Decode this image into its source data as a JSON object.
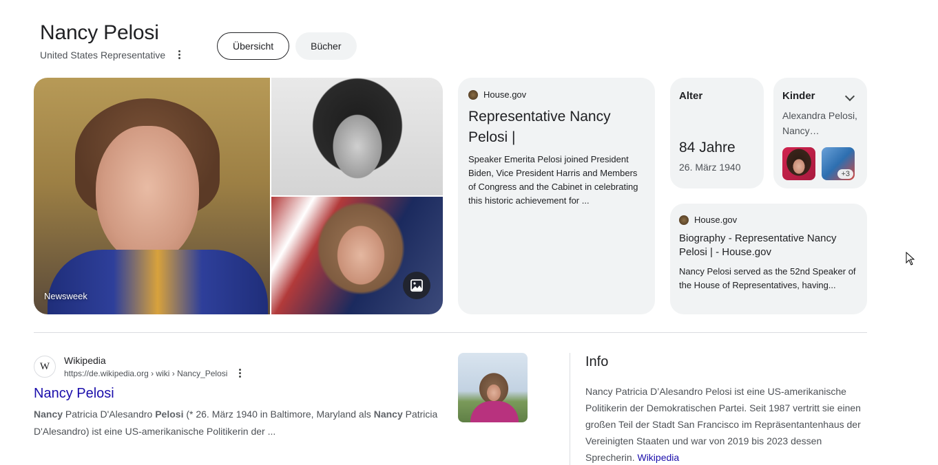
{
  "header": {
    "title": "Nancy Pelosi",
    "subtitle": "United States Representative"
  },
  "tabs": [
    {
      "label": "Übersicht",
      "active": true
    },
    {
      "label": "Bücher",
      "active": false
    }
  ],
  "gallery": {
    "caption": "Newsweek"
  },
  "source_card_1": {
    "source": "House.gov",
    "title": "Representative Nancy Pelosi |",
    "description": "Speaker Emerita Pelosi joined President Biden, Vice President Harris and Members of Congress and the Cabinet in celebrating this historic achievement for ..."
  },
  "age_card": {
    "label": "Alter",
    "value": "84 Jahre",
    "birthdate": "26. März 1940"
  },
  "children_card": {
    "label": "Kinder",
    "names": "Alexandra Pelosi, Nancy…",
    "more_count": "+3"
  },
  "source_card_2": {
    "source": "House.gov",
    "title": "Biography - Representative Nancy Pelosi | - House.gov",
    "description": "Nancy Pelosi served as the 52nd Speaker of the House of Representatives, having..."
  },
  "result": {
    "favicon_letter": "W",
    "site_name": "Wikipedia",
    "url": "https://de.wikipedia.org › wiki › Nancy_Pelosi",
    "title": "Nancy Pelosi",
    "snippet_parts": [
      "Nancy",
      " Patricia D'Alesandro ",
      "Pelosi",
      " (* 26. März 1940 in Baltimore, Maryland als ",
      "Nancy",
      " Patricia D'Alesandro) ist eine US-amerikanische Politikerin der ..."
    ]
  },
  "info": {
    "heading": "Info",
    "text": "Nancy Patricia D’Alesandro Pelosi ist eine US-amerikanische Politikerin der Demokratischen Partei. Seit 1987 vertritt sie einen großen Teil der Stadt San Francisco im Repräsentantenhaus der Vereinigten Staaten und war von 2019 bis 2023 dessen Sprecherin.",
    "link": "Wikipedia"
  },
  "icons": {
    "more": "more-vert-icon",
    "images": "image-icon",
    "expand": "chevron-down-icon",
    "seal": "house-seal-icon"
  },
  "colors": {
    "link": "#1a0dab",
    "card_bg": "#f1f3f4",
    "text": "#202124",
    "muted": "#4d5156"
  }
}
